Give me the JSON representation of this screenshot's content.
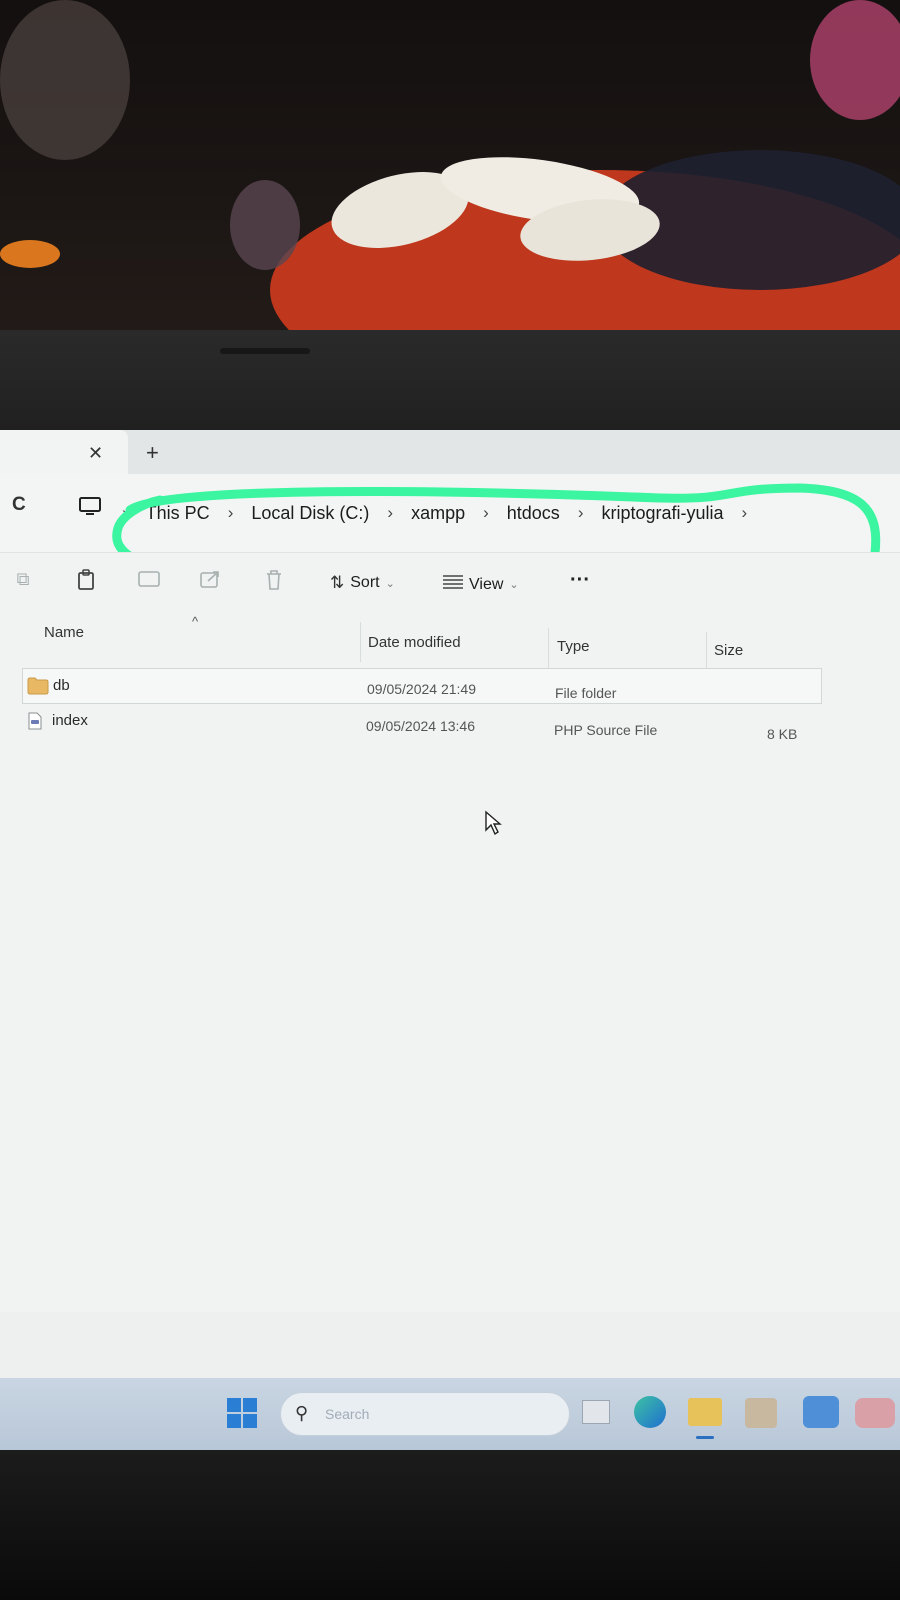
{
  "tabs": {
    "close_glyph": "✕",
    "new_tab_glyph": "+"
  },
  "address": {
    "refresh_glyph": "C",
    "sep": "›",
    "crumbs": [
      "This PC",
      "Local Disk (C:)",
      "xampp",
      "htdocs",
      "kriptografi-yulia"
    ]
  },
  "toolbar": {
    "sort_label": "Sort",
    "view_label": "View",
    "more_label": "···"
  },
  "columns": {
    "name": "Name",
    "date": "Date modified",
    "type": "Type",
    "size": "Size"
  },
  "files": [
    {
      "name": "db",
      "date": "09/05/2024 21:49",
      "type": "File folder",
      "size": "",
      "icon": "folder-icon"
    },
    {
      "name": "index",
      "date": "09/05/2024 13:46",
      "type": "PHP Source File",
      "size": "8 KB",
      "icon": "php-file-icon"
    }
  ],
  "taskbar": {
    "search_placeholder": "Search"
  },
  "colors": {
    "highlight": "#3cf5a0",
    "folder": "#e8b864",
    "taskbar": "#c2d0df"
  }
}
